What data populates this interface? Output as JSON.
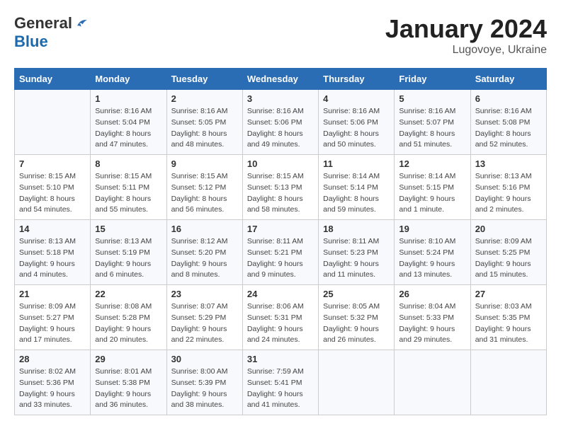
{
  "header": {
    "logo_general": "General",
    "logo_blue": "Blue",
    "title": "January 2024",
    "location": "Lugovoye, Ukraine"
  },
  "columns": [
    "Sunday",
    "Monday",
    "Tuesday",
    "Wednesday",
    "Thursday",
    "Friday",
    "Saturday"
  ],
  "weeks": [
    [
      {
        "day": "",
        "info": ""
      },
      {
        "day": "1",
        "info": "Sunrise: 8:16 AM\nSunset: 5:04 PM\nDaylight: 8 hours\nand 47 minutes."
      },
      {
        "day": "2",
        "info": "Sunrise: 8:16 AM\nSunset: 5:05 PM\nDaylight: 8 hours\nand 48 minutes."
      },
      {
        "day": "3",
        "info": "Sunrise: 8:16 AM\nSunset: 5:06 PM\nDaylight: 8 hours\nand 49 minutes."
      },
      {
        "day": "4",
        "info": "Sunrise: 8:16 AM\nSunset: 5:06 PM\nDaylight: 8 hours\nand 50 minutes."
      },
      {
        "day": "5",
        "info": "Sunrise: 8:16 AM\nSunset: 5:07 PM\nDaylight: 8 hours\nand 51 minutes."
      },
      {
        "day": "6",
        "info": "Sunrise: 8:16 AM\nSunset: 5:08 PM\nDaylight: 8 hours\nand 52 minutes."
      }
    ],
    [
      {
        "day": "7",
        "info": "Sunrise: 8:15 AM\nSunset: 5:10 PM\nDaylight: 8 hours\nand 54 minutes."
      },
      {
        "day": "8",
        "info": "Sunrise: 8:15 AM\nSunset: 5:11 PM\nDaylight: 8 hours\nand 55 minutes."
      },
      {
        "day": "9",
        "info": "Sunrise: 8:15 AM\nSunset: 5:12 PM\nDaylight: 8 hours\nand 56 minutes."
      },
      {
        "day": "10",
        "info": "Sunrise: 8:15 AM\nSunset: 5:13 PM\nDaylight: 8 hours\nand 58 minutes."
      },
      {
        "day": "11",
        "info": "Sunrise: 8:14 AM\nSunset: 5:14 PM\nDaylight: 8 hours\nand 59 minutes."
      },
      {
        "day": "12",
        "info": "Sunrise: 8:14 AM\nSunset: 5:15 PM\nDaylight: 9 hours\nand 1 minute."
      },
      {
        "day": "13",
        "info": "Sunrise: 8:13 AM\nSunset: 5:16 PM\nDaylight: 9 hours\nand 2 minutes."
      }
    ],
    [
      {
        "day": "14",
        "info": "Sunrise: 8:13 AM\nSunset: 5:18 PM\nDaylight: 9 hours\nand 4 minutes."
      },
      {
        "day": "15",
        "info": "Sunrise: 8:13 AM\nSunset: 5:19 PM\nDaylight: 9 hours\nand 6 minutes."
      },
      {
        "day": "16",
        "info": "Sunrise: 8:12 AM\nSunset: 5:20 PM\nDaylight: 9 hours\nand 8 minutes."
      },
      {
        "day": "17",
        "info": "Sunrise: 8:11 AM\nSunset: 5:21 PM\nDaylight: 9 hours\nand 9 minutes."
      },
      {
        "day": "18",
        "info": "Sunrise: 8:11 AM\nSunset: 5:23 PM\nDaylight: 9 hours\nand 11 minutes."
      },
      {
        "day": "19",
        "info": "Sunrise: 8:10 AM\nSunset: 5:24 PM\nDaylight: 9 hours\nand 13 minutes."
      },
      {
        "day": "20",
        "info": "Sunrise: 8:09 AM\nSunset: 5:25 PM\nDaylight: 9 hours\nand 15 minutes."
      }
    ],
    [
      {
        "day": "21",
        "info": "Sunrise: 8:09 AM\nSunset: 5:27 PM\nDaylight: 9 hours\nand 17 minutes."
      },
      {
        "day": "22",
        "info": "Sunrise: 8:08 AM\nSunset: 5:28 PM\nDaylight: 9 hours\nand 20 minutes."
      },
      {
        "day": "23",
        "info": "Sunrise: 8:07 AM\nSunset: 5:29 PM\nDaylight: 9 hours\nand 22 minutes."
      },
      {
        "day": "24",
        "info": "Sunrise: 8:06 AM\nSunset: 5:31 PM\nDaylight: 9 hours\nand 24 minutes."
      },
      {
        "day": "25",
        "info": "Sunrise: 8:05 AM\nSunset: 5:32 PM\nDaylight: 9 hours\nand 26 minutes."
      },
      {
        "day": "26",
        "info": "Sunrise: 8:04 AM\nSunset: 5:33 PM\nDaylight: 9 hours\nand 29 minutes."
      },
      {
        "day": "27",
        "info": "Sunrise: 8:03 AM\nSunset: 5:35 PM\nDaylight: 9 hours\nand 31 minutes."
      }
    ],
    [
      {
        "day": "28",
        "info": "Sunrise: 8:02 AM\nSunset: 5:36 PM\nDaylight: 9 hours\nand 33 minutes."
      },
      {
        "day": "29",
        "info": "Sunrise: 8:01 AM\nSunset: 5:38 PM\nDaylight: 9 hours\nand 36 minutes."
      },
      {
        "day": "30",
        "info": "Sunrise: 8:00 AM\nSunset: 5:39 PM\nDaylight: 9 hours\nand 38 minutes."
      },
      {
        "day": "31",
        "info": "Sunrise: 7:59 AM\nSunset: 5:41 PM\nDaylight: 9 hours\nand 41 minutes."
      },
      {
        "day": "",
        "info": ""
      },
      {
        "day": "",
        "info": ""
      },
      {
        "day": "",
        "info": ""
      }
    ]
  ]
}
